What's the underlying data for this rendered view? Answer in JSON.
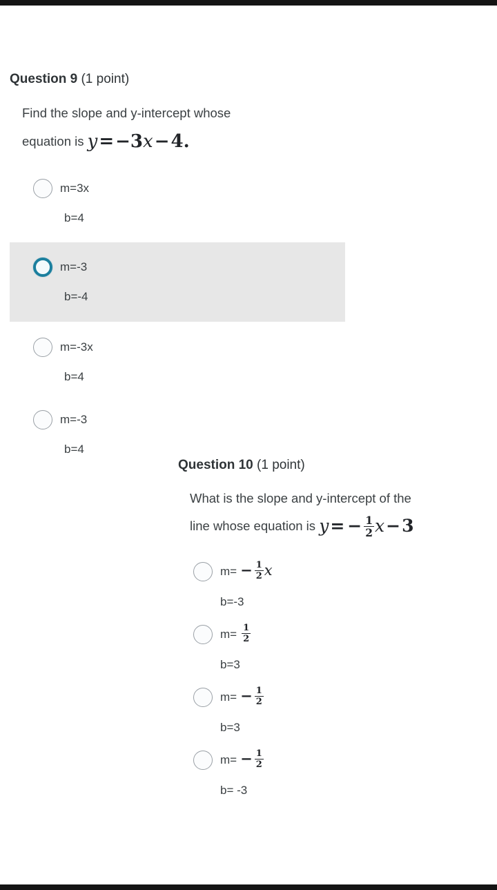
{
  "document": {
    "background_color": "#ffffff",
    "text_color": "#3b4043",
    "selected_accent_color": "#1b7f9e",
    "selected_row_background": "#e7e7e7",
    "edge_bar_color": "#141414"
  },
  "questions": [
    {
      "id": "question-9",
      "label": "Question 9",
      "points": "(1 point)",
      "stem_line1": "Find the slope and y-intercept whose",
      "stem_line2_prefix": "equation is",
      "stem_equation": {
        "lhs": "y",
        "eq": "=",
        "terms": "−3x − 4",
        "trailing": "."
      },
      "options": [
        {
          "id": "q9-option-1",
          "slope": "m=3x",
          "intercept": "b=4",
          "selected": false
        },
        {
          "id": "q9-option-2",
          "slope": "m=-3",
          "intercept": "b=-4",
          "selected": true
        },
        {
          "id": "q9-option-3",
          "slope": "m=-3x",
          "intercept": "b=4",
          "selected": false
        },
        {
          "id": "q9-option-4",
          "slope": "m=-3",
          "intercept": "b=4",
          "selected": false
        }
      ]
    },
    {
      "id": "question-10",
      "label": "Question 10",
      "points": "(1 point)",
      "stem_line1": "What is the slope and y-intercept of the",
      "stem_line2_prefix": "line whose equation is",
      "stem_equation": {
        "lhs": "y",
        "eq": "=",
        "minus": "−",
        "numerator": "1",
        "denominator": "2",
        "variable": "x",
        "minus2": "−",
        "constant": "3"
      },
      "options": [
        {
          "id": "q10-option-1",
          "slope_prefix": "m=",
          "slope_minus": "−",
          "slope_numerator": "1",
          "slope_denominator": "2",
          "slope_variable": "x",
          "intercept": "b=-3",
          "selected": false
        },
        {
          "id": "q10-option-2",
          "slope_prefix": "m=",
          "slope_minus": "",
          "slope_numerator": "1",
          "slope_denominator": "2",
          "slope_variable": "",
          "intercept": "b=3",
          "selected": false
        },
        {
          "id": "q10-option-3",
          "slope_prefix": "m=",
          "slope_minus": "−",
          "slope_numerator": "1",
          "slope_denominator": "2",
          "slope_variable": "",
          "intercept": "b=3",
          "selected": false
        },
        {
          "id": "q10-option-4",
          "slope_prefix": "m=",
          "slope_minus": "−",
          "slope_numerator": "1",
          "slope_denominator": "2",
          "slope_variable": "",
          "intercept": "b= -3",
          "selected": false
        }
      ]
    }
  ]
}
